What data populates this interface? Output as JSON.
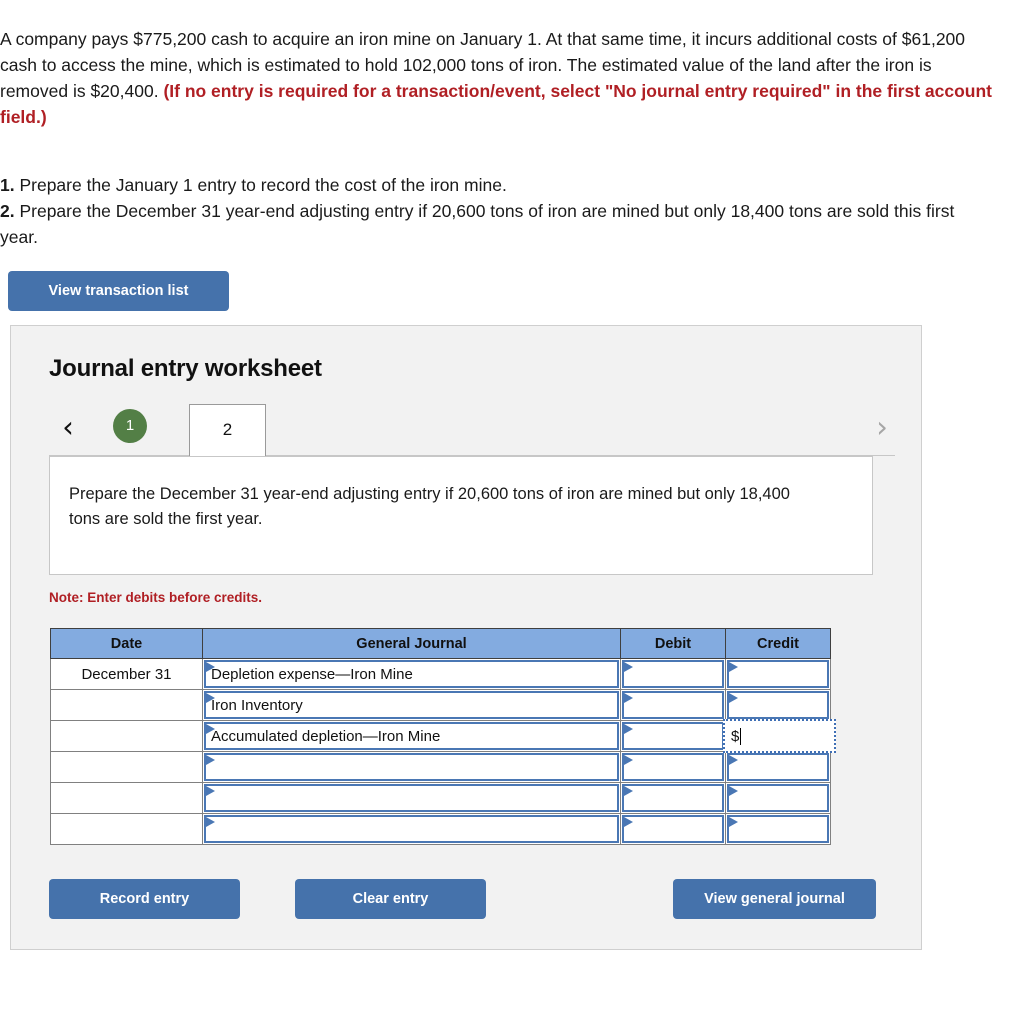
{
  "problem": {
    "paragraph_part1": "A company pays $775,200 cash to acquire an iron mine on January 1. At that same time, it incurs additional costs of $61,200 cash to access the mine, which is estimated to hold 102,000 tons of iron. The estimated value of the land after the iron is removed is $20,400. ",
    "paragraph_red": "(If no entry is required for a transaction/event, select \"No journal entry required\" in the first account field.)"
  },
  "requirements": [
    {
      "num": "1.",
      "text": " Prepare the January 1 entry to record the cost of the iron mine."
    },
    {
      "num": "2.",
      "text": " Prepare the December 31 year-end adjusting entry if 20,600 tons of iron are mined but only 18,400 tons are sold this first year."
    }
  ],
  "toolbar": {
    "view_transaction_list_label": "View transaction list"
  },
  "worksheet": {
    "title": "Journal entry worksheet",
    "prev_chevron": "‹",
    "next_chevron": "›",
    "tabs": [
      {
        "label": "1",
        "state": "completed"
      },
      {
        "label": "2",
        "state": "active"
      }
    ],
    "prompt": "Prepare the December 31 year-end adjusting entry if 20,600 tons of iron are mined but only 18,400 tons are sold the first year.",
    "note": "Note: Enter debits before credits.",
    "table": {
      "headers": [
        "Date",
        "General Journal",
        "Debit",
        "Credit"
      ],
      "rows": [
        {
          "date": "December 31",
          "account": "Depletion expense—Iron Mine",
          "debit": "",
          "credit": ""
        },
        {
          "date": "",
          "account": "Iron Inventory",
          "debit": "",
          "credit": ""
        },
        {
          "date": "",
          "account": "Accumulated depletion—Iron Mine",
          "debit": "",
          "credit": "$"
        },
        {
          "date": "",
          "account": "",
          "debit": "",
          "credit": ""
        },
        {
          "date": "",
          "account": "",
          "debit": "",
          "credit": ""
        },
        {
          "date": "",
          "account": "",
          "debit": "",
          "credit": ""
        }
      ]
    },
    "buttons": {
      "record_entry": "Record entry",
      "clear_entry": "Clear entry",
      "view_general_journal": "View general journal"
    }
  },
  "colors": {
    "button_blue": "#4572ab",
    "header_blue": "#83abe0",
    "cell_border_blue": "#4a77b4",
    "tab_green": "#537f46",
    "red_text": "#b01f24",
    "panel_gray": "#f2f2f2"
  }
}
